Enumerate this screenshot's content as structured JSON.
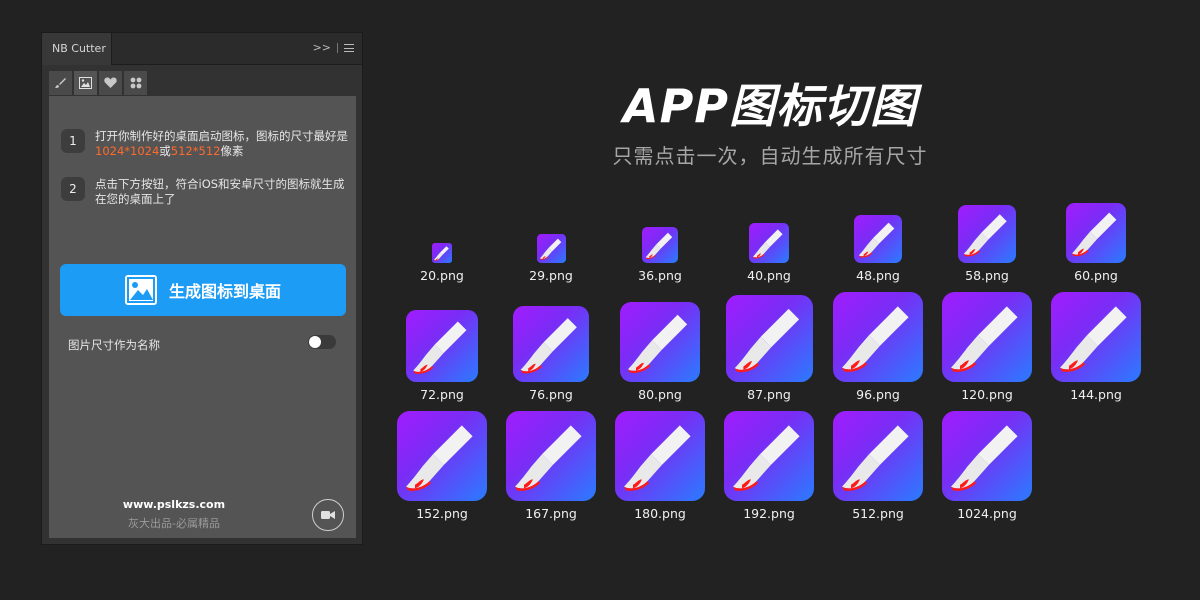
{
  "panel": {
    "tab_title": "NB Cutter",
    "menu_collapse": ">>",
    "tools": [
      "brush-icon",
      "image-icon",
      "heart-icon",
      "grid-icon"
    ],
    "steps": [
      {
        "num": "1",
        "text_a": "打开你制作好的桌面启动图标，图标的尺寸最好是",
        "size_a": "1024*1024",
        "or": "或",
        "size_b": "512*512",
        "text_b": "像素"
      },
      {
        "num": "2",
        "text": "点击下方按钮，符合iOS和安卓尺寸的图标就生成在您的桌面上了"
      }
    ],
    "generate_button": "生成图标到桌面",
    "toggle_label": "图片尺寸作为名称",
    "toggle_on": false,
    "website": "www.pslkzs.com",
    "slogan": "灰大出品-必属精品"
  },
  "headline": {
    "title": "APP图标切图",
    "subtitle": "只需点击一次，自动生成所有尺寸"
  },
  "icons": [
    "20.png",
    "29.png",
    "36.png",
    "40.png",
    "48.png",
    "58.png",
    "60.png",
    "72.png",
    "76.png",
    "80.png",
    "87.png",
    "96.png",
    "120.png",
    "144.png",
    "152.png",
    "167.png",
    "180.png",
    "192.png",
    "512.png",
    "1024.png"
  ],
  "colors": {
    "accent": "#1d9cf5",
    "highlight": "#ff6a2b",
    "icon_gradient_start": "#a21cff",
    "icon_gradient_end": "#2a7bff"
  }
}
